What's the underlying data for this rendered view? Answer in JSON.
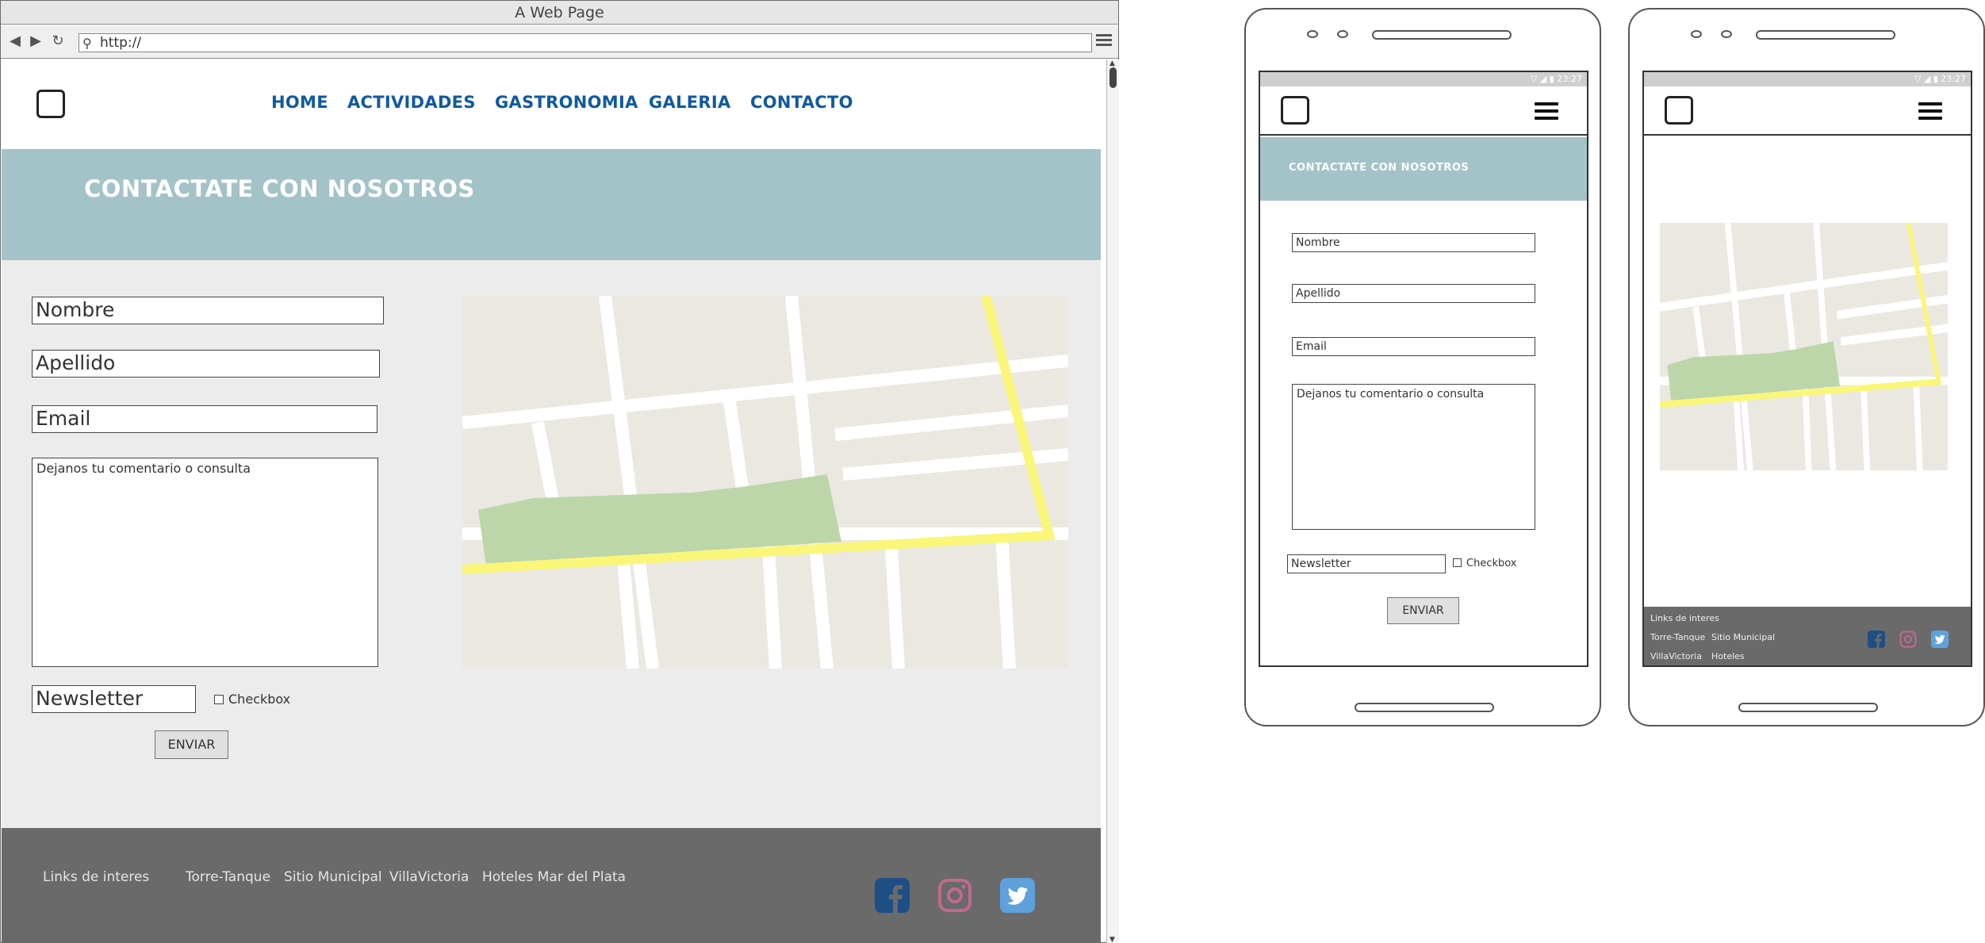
{
  "browser": {
    "title": "A Web Page",
    "url": "http://"
  },
  "site": {
    "nav": [
      "HOME",
      "ACTIVIDADES",
      "GASTRONOMIA",
      "GALERIA",
      "CONTACTO"
    ],
    "hero_title": "CONTACTATE CON NOSOTROS",
    "form": {
      "nombre": "Nombre",
      "apellido": "Apellido",
      "email": "Email",
      "comentario": "Dejanos tu comentario o consulta",
      "newsletter": "Newsletter",
      "checkbox_label": "Checkbox",
      "submit": "ENVIAR"
    },
    "footer": {
      "heading": "Links de interes",
      "links": [
        "Torre-Tanque",
        "Sitio Municipal",
        "VillaVictoria",
        "Hoteles Mar del Plata"
      ],
      "mobile_links": [
        "Torre-Tanque",
        "Sitio Municipal",
        "VillaVictoria",
        "Hoteles"
      ]
    },
    "social_icons": [
      "facebook-icon",
      "instagram-icon",
      "twitter-icon"
    ]
  },
  "mobile": {
    "status_time": "23:27"
  },
  "colors": {
    "nav_text": "#0f5aa0",
    "hero_bg": "#a3c3c8",
    "page_bg": "#ececec",
    "footer_bg": "#6a6a6a",
    "facebook": "#1d4f85",
    "instagram": "#c26a8e",
    "twitter": "#5fa1da",
    "map_park": "#bcd6aa",
    "map_highway": "#faf67a"
  }
}
